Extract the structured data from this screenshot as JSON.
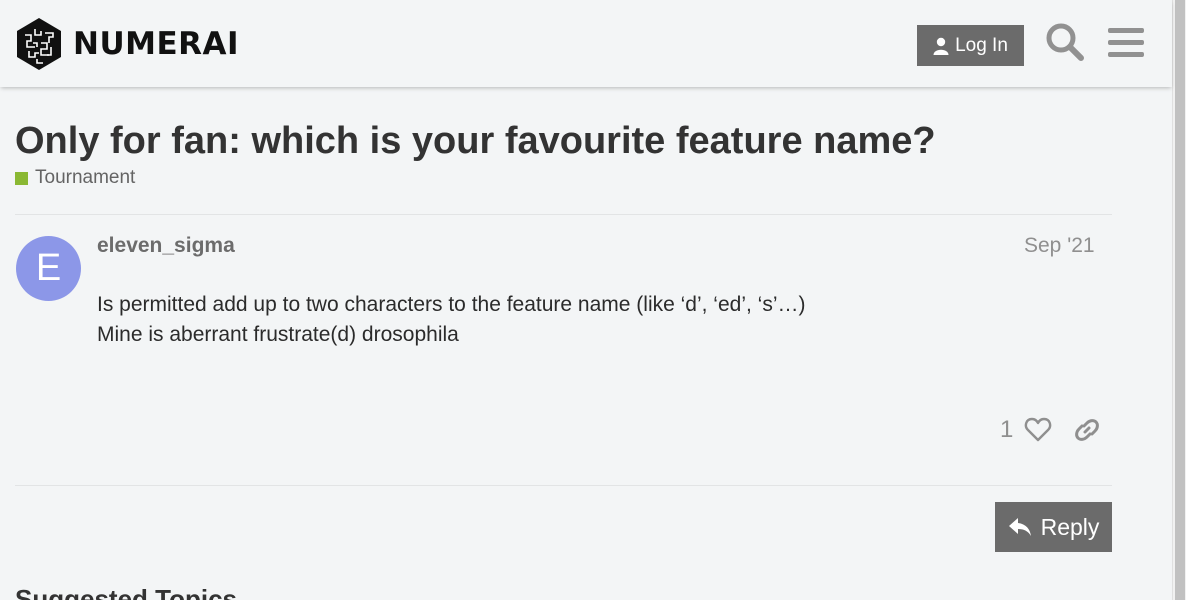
{
  "header": {
    "brand": "NUMERAI",
    "login_label": "Log In"
  },
  "topic": {
    "title": "Only for fan: which is your favourite feature name?",
    "category": "Tournament",
    "category_color": "#8ab833"
  },
  "post": {
    "avatar_letter": "E",
    "avatar_color": "#8c97e8",
    "username": "eleven_sigma",
    "date": "Sep '21",
    "lines": [
      "Is permitted add up to two characters to the feature name (like ‘d’, ‘ed’, ‘s’…)",
      "Mine is aberrant frustrate(d) drosophila"
    ],
    "like_count": "1"
  },
  "actions": {
    "reply_label": "Reply"
  },
  "suggested": {
    "heading": "Suggested Topics"
  },
  "icons": {
    "user": "user-icon",
    "search": "search-icon",
    "menu": "hamburger-menu-icon",
    "heart": "heart-icon",
    "link": "link-icon",
    "reply": "reply-icon"
  }
}
